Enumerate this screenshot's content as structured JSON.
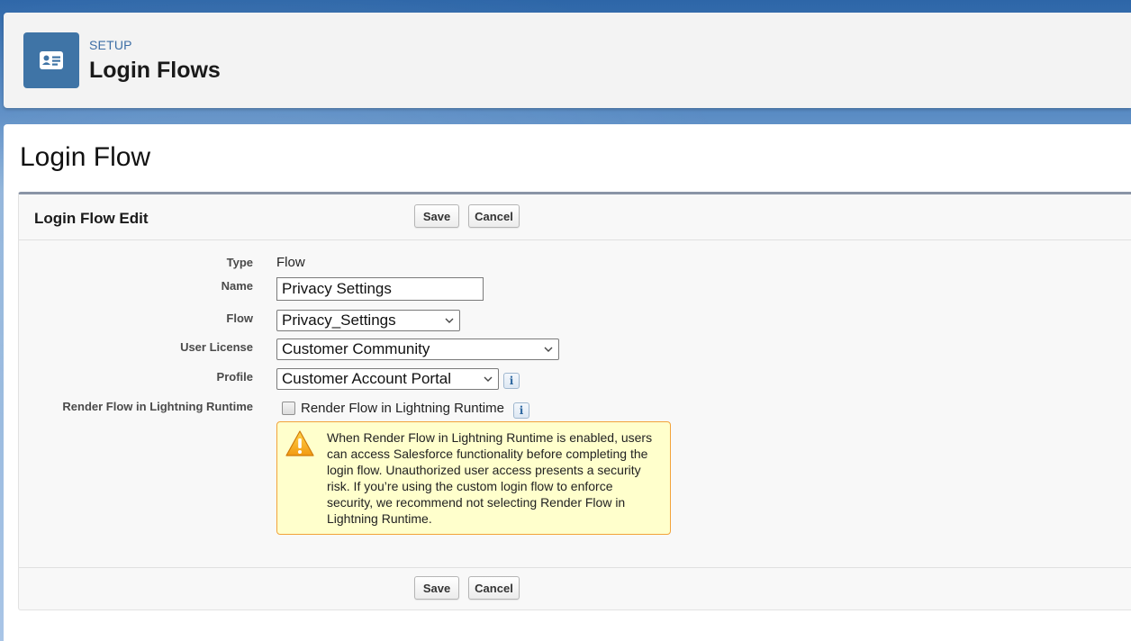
{
  "header": {
    "eyebrow": "SETUP",
    "title": "Login Flows",
    "icon": "contact-card-icon"
  },
  "page": {
    "title": "Login Flow"
  },
  "edit_block": {
    "title": "Login Flow Edit",
    "save_label": "Save",
    "cancel_label": "Cancel"
  },
  "fields": {
    "type": {
      "label": "Type",
      "value": "Flow"
    },
    "name": {
      "label": "Name",
      "value": "Privacy Settings"
    },
    "flow": {
      "label": "Flow",
      "selected": "Privacy_Settings"
    },
    "user_license": {
      "label": "User License",
      "selected": "Customer Community"
    },
    "profile": {
      "label": "Profile",
      "selected": "Customer Account Portal"
    },
    "render_flow": {
      "label": "Render Flow in Lightning Runtime",
      "checkbox_label": "Render Flow in Lightning Runtime",
      "checked": false
    }
  },
  "warning": {
    "icon": "warning-icon",
    "text": "When Render Flow in Lightning Runtime is enabled, users can access Salesforce functionality before completing the login flow. Unauthorized user access presents a security risk. If you’re using the custom login flow to enforce security, we recommend not selecting Render Flow in Lightning Runtime."
  },
  "info_glyph": "i",
  "colors": {
    "header_icon_bg": "#3f74a6",
    "eyebrow": "#3d6ea5",
    "warning_bg": "#ffffcc",
    "warning_border": "#f2a33a"
  }
}
